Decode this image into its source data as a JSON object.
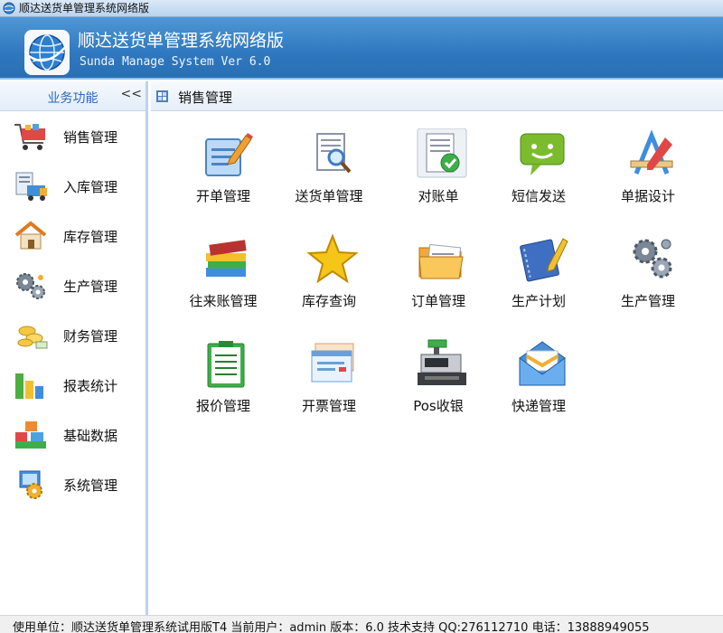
{
  "window": {
    "title": "顺达送货单管理系统网络版"
  },
  "banner": {
    "name": "顺达送货单管理系统网络版",
    "subtitle": "Sunda Manage System Ver 6.0"
  },
  "sidebar": {
    "header": "业务功能",
    "collapse": "<<",
    "items": [
      {
        "label": "销售管理",
        "icon": "shopping-cart-icon"
      },
      {
        "label": "入库管理",
        "icon": "warehouse-in-icon"
      },
      {
        "label": "库存管理",
        "icon": "house-icon"
      },
      {
        "label": "生产管理",
        "icon": "gears-icon"
      },
      {
        "label": "财务管理",
        "icon": "coins-icon"
      },
      {
        "label": "报表统计",
        "icon": "bar-chart-icon"
      },
      {
        "label": "基础数据",
        "icon": "blocks-icon"
      },
      {
        "label": "系统管理",
        "icon": "system-icon"
      }
    ]
  },
  "content": {
    "header": "销售管理",
    "tiles": [
      {
        "label": "开单管理",
        "icon": "form-pencil-icon"
      },
      {
        "label": "送货单管理",
        "icon": "document-search-icon"
      },
      {
        "label": "对账单",
        "icon": "document-check-icon"
      },
      {
        "label": "短信发送",
        "icon": "sms-icon"
      },
      {
        "label": "单据设计",
        "icon": "design-tools-icon"
      },
      {
        "label": "往来账管理",
        "icon": "books-icon"
      },
      {
        "label": "库存查询",
        "icon": "star-icon"
      },
      {
        "label": "订单管理",
        "icon": "folders-icon"
      },
      {
        "label": "生产计划",
        "icon": "notebook-pen-icon"
      },
      {
        "label": "生产管理",
        "icon": "gears-icon"
      },
      {
        "label": "报价管理",
        "icon": "clipboard-icon"
      },
      {
        "label": "开票管理",
        "icon": "invoice-window-icon"
      },
      {
        "label": "Pos收银",
        "icon": "cash-register-icon"
      },
      {
        "label": "快递管理",
        "icon": "envelope-icon"
      }
    ]
  },
  "statusbar": {
    "text": "使用单位：顺达送货单管理系统试用版T4  当前用户：admin  版本：6.0  技术支持 QQ:276112710 电话：13888949055"
  },
  "colors": {
    "banner": "#2f78bf",
    "sidebar_border": "#bcd3ee",
    "header_text": "#2b66b8"
  }
}
